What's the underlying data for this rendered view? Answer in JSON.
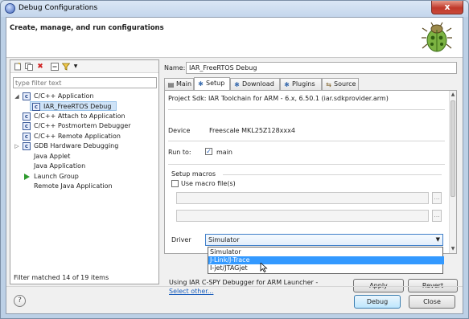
{
  "window": {
    "title": "Debug Configurations",
    "close_label": "x"
  },
  "header": {
    "title": "Create, manage, and run configurations"
  },
  "left": {
    "toolbar_icons": [
      "new-config-icon",
      "duplicate-icon",
      "delete-icon",
      "collapse-icon",
      "filter-icon",
      "chevron-down-icon"
    ],
    "filter_placeholder": "type filter text",
    "tree": [
      {
        "label": "C/C++ Application",
        "expanded": true,
        "icon": "c-app-icon"
      },
      {
        "label": "IAR_FreeRTOS Debug",
        "selected": true,
        "icon": "c-app-icon"
      },
      {
        "label": "C/C++ Attach to Application",
        "icon": "c-app-icon"
      },
      {
        "label": "C/C++ Postmortem Debugger",
        "icon": "c-app-icon"
      },
      {
        "label": "C/C++ Remote Application",
        "icon": "c-app-icon"
      },
      {
        "label": "GDB Hardware Debugging",
        "collapsed": true,
        "icon": "c-app-icon"
      },
      {
        "label": "Java Applet"
      },
      {
        "label": "Java Application"
      },
      {
        "label": "Launch Group",
        "icon": "launch-icon"
      },
      {
        "label": "Remote Java Application"
      }
    ],
    "status": "Filter matched 14 of 19 items"
  },
  "main": {
    "name_label": "Name:",
    "name_value": "IAR_FreeRTOS Debug",
    "tabs": [
      "Main",
      "Setup",
      "Download",
      "Plugins",
      "Source"
    ],
    "active_tab": "Setup",
    "project_sdk": "Project Sdk:  IAR Toolchain for ARM - 6.x, 6.50.1 (iar.sdkprovider.arm)",
    "device_label": "Device",
    "device_value": "Freescale MKL25Z128xxx4",
    "runto_label": "Run to:",
    "runto_checked": true,
    "runto_value": "main",
    "setup_macros_label": "Setup macros",
    "use_macro_label": "Use macro file(s)",
    "use_macro_checked": false,
    "driver_label": "Driver",
    "driver_selected": "Simulator",
    "driver_options": [
      "Simulator",
      "J-Link/J-Trace",
      "I-jet/JTAGjet"
    ],
    "driver_highlight": "J-Link/J-Trace",
    "launcher_text": "Using IAR C-SPY Debugger for ARM Launcher - ",
    "launcher_link": "Select other...",
    "apply_label": "Apply",
    "revert_label": "Revert",
    "browse_label": "..."
  },
  "footer": {
    "help_label": "?",
    "debug_label": "Debug",
    "close_label": "Close"
  }
}
